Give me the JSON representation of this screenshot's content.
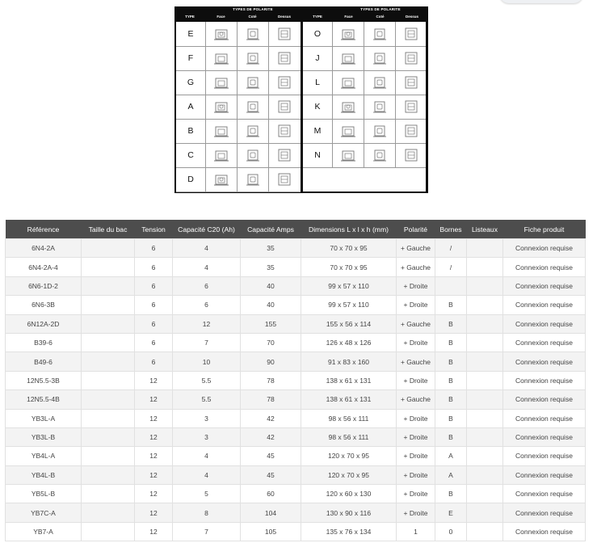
{
  "polarity": {
    "header_left": {
      "group": "TYPES DE POLARITE",
      "type": "TYPE",
      "face": "Face",
      "cote": "Coté",
      "dessus": "Dessus"
    },
    "header_right": {
      "group": "TYPES DE POLARITE",
      "type": "TYPE",
      "face": "Face",
      "cote": "Coté",
      "dessus": "Dessus"
    },
    "left": [
      {
        "type": "E",
        "icons": [
          "battery-face-icon",
          "battery-side-icon",
          "battery-top-icon"
        ]
      },
      {
        "type": "F",
        "icons": [
          "battery-face-icon",
          "battery-side-icon",
          "battery-top-icon"
        ]
      },
      {
        "type": "G",
        "icons": [
          "battery-face-icon",
          "battery-side-icon",
          "battery-top-icon"
        ]
      },
      {
        "type": "A",
        "icons": [
          "battery-face-icon",
          "battery-side-icon",
          "battery-top-icon"
        ]
      },
      {
        "type": "B",
        "icons": [
          "battery-face-icon",
          "battery-side-icon",
          "battery-top-icon"
        ]
      },
      {
        "type": "C",
        "icons": [
          "battery-face-icon",
          "battery-side-icon",
          "battery-top-icon"
        ]
      },
      {
        "type": "D",
        "icons": [
          "battery-face-icon",
          "battery-side-icon",
          "battery-top-icon"
        ]
      }
    ],
    "right": [
      {
        "type": "O",
        "icons": [
          "battery-face-icon",
          "battery-side-icon",
          "battery-top-icon"
        ]
      },
      {
        "type": "J",
        "icons": [
          "battery-face-icon",
          "battery-side-icon",
          "battery-top-icon"
        ]
      },
      {
        "type": "L",
        "icons": [
          "battery-face-icon",
          "battery-side-icon",
          "battery-top-icon"
        ]
      },
      {
        "type": "K",
        "icons": [
          "battery-face-icon",
          "battery-side-icon",
          "battery-top-icon"
        ]
      },
      {
        "type": "M",
        "icons": [
          "battery-face-icon",
          "battery-side-icon",
          "battery-top-icon"
        ]
      },
      {
        "type": "N",
        "icons": [
          "battery-face-icon",
          "battery-side-icon",
          "battery-top-icon"
        ]
      }
    ]
  },
  "table": {
    "headers": [
      "Référence",
      "Taille du bac",
      "Tension",
      "Capacité C20 (Ah)",
      "Capacité Amps",
      "Dimensions L x l x h (mm)",
      "Polarité",
      "Bornes",
      "Listeaux",
      "Fiche produit"
    ],
    "rows": [
      [
        "6N4-2A",
        "",
        "6",
        "4",
        "35",
        "70 x 70 x 95",
        "+ Gauche",
        "/",
        "",
        "Connexion requise"
      ],
      [
        "6N4-2A-4",
        "",
        "6",
        "4",
        "35",
        "70 x 70 x 95",
        "+ Gauche",
        "/",
        "",
        "Connexion requise"
      ],
      [
        "6N6-1D-2",
        "",
        "6",
        "6",
        "40",
        "99 x 57 x 110",
        "+ Droite",
        "",
        "",
        "Connexion requise"
      ],
      [
        "6N6-3B",
        "",
        "6",
        "6",
        "40",
        "99 x 57 x 110",
        "+ Droite",
        "B",
        "",
        "Connexion requise"
      ],
      [
        "6N12A-2D",
        "",
        "6",
        "12",
        "155",
        "155 x 56 x 114",
        "+ Gauche",
        "B",
        "",
        "Connexion requise"
      ],
      [
        "B39-6",
        "",
        "6",
        "7",
        "70",
        "126 x 48 x 126",
        "+ Droite",
        "B",
        "",
        "Connexion requise"
      ],
      [
        "B49-6",
        "",
        "6",
        "10",
        "90",
        "91 x 83 x 160",
        "+ Gauche",
        "B",
        "",
        "Connexion requise"
      ],
      [
        "12N5.5-3B",
        "",
        "12",
        "5.5",
        "78",
        "138 x 61 x 131",
        "+ Droite",
        "B",
        "",
        "Connexion requise"
      ],
      [
        "12N5.5-4B",
        "",
        "12",
        "5.5",
        "78",
        "138 x 61 x 131",
        "+ Gauche",
        "B",
        "",
        "Connexion requise"
      ],
      [
        "YB3L-A",
        "",
        "12",
        "3",
        "42",
        "98 x 56 x 111",
        "+ Droite",
        "B",
        "",
        "Connexion requise"
      ],
      [
        "YB3L-B",
        "",
        "12",
        "3",
        "42",
        "98 x 56 x 111",
        "+ Droite",
        "B",
        "",
        "Connexion requise"
      ],
      [
        "YB4L-A",
        "",
        "12",
        "4",
        "45",
        "120 x 70 x 95",
        "+ Droite",
        "A",
        "",
        "Connexion requise"
      ],
      [
        "YB4L-B",
        "",
        "12",
        "4",
        "45",
        "120 x 70 x 95",
        "+ Droite",
        "A",
        "",
        "Connexion requise"
      ],
      [
        "YB5L-B",
        "",
        "12",
        "5",
        "60",
        "120 x 60 x 130",
        "+ Droite",
        "B",
        "",
        "Connexion requise"
      ],
      [
        "YB7C-A",
        "",
        "12",
        "8",
        "104",
        "130 x 90 x 116",
        "+ Droite",
        "E",
        "",
        "Connexion requise"
      ],
      [
        "YB7-A",
        "",
        "12",
        "7",
        "105",
        "135 x 76 x 134",
        "1",
        "0",
        "",
        "Connexion requise"
      ]
    ]
  },
  "colors": {
    "header_bg": "#4d4d4d",
    "row_alt": "#f3f3f3",
    "diagram_frame": "#0d0d0d"
  }
}
